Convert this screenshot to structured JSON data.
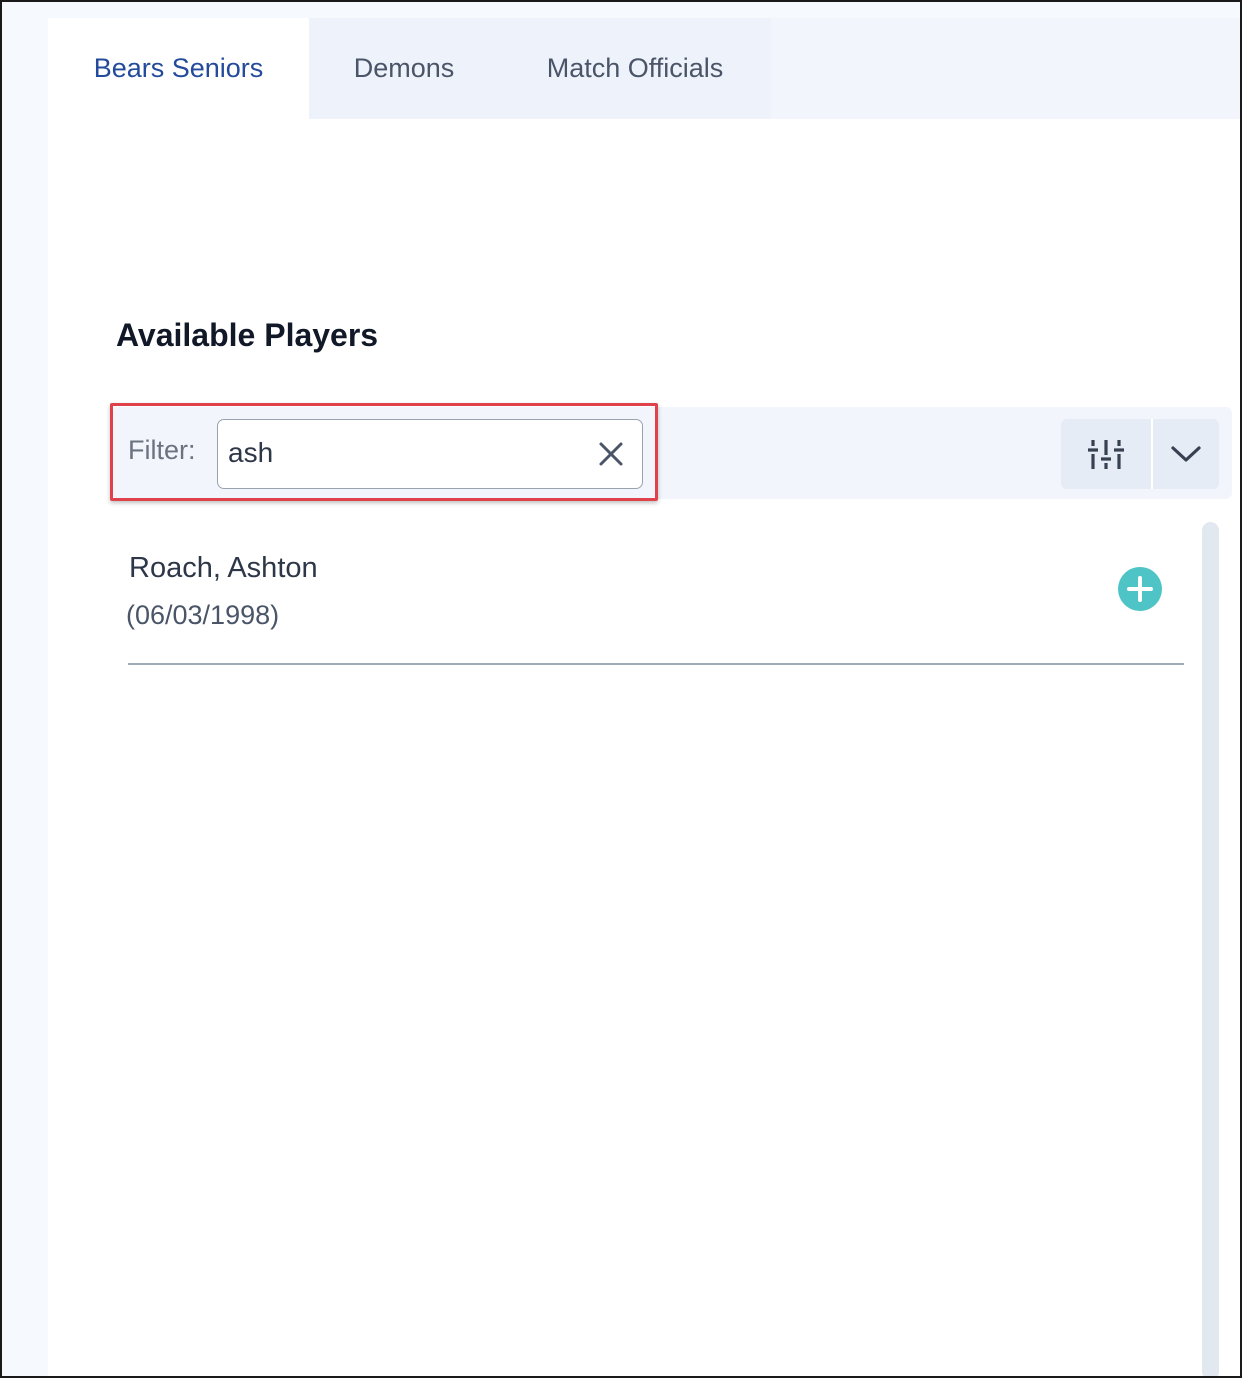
{
  "tabs": [
    {
      "label": "Bears Seniors",
      "active": true
    },
    {
      "label": "Demons",
      "active": false
    },
    {
      "label": "Match Officials",
      "active": false
    }
  ],
  "section": {
    "title": "Available Players"
  },
  "filter": {
    "label": "Filter:",
    "value": "ash"
  },
  "players": [
    {
      "name": "Roach, Ashton",
      "dob": "(06/03/1998)"
    }
  ],
  "colors": {
    "accent_tab": "#244b9b",
    "add_button": "#4fc4c6",
    "highlight": "#e0424c"
  },
  "icons": {
    "clear": "close-icon",
    "settings": "sliders-icon",
    "dropdown": "chevron-down-icon",
    "add": "plus-circle-icon"
  }
}
